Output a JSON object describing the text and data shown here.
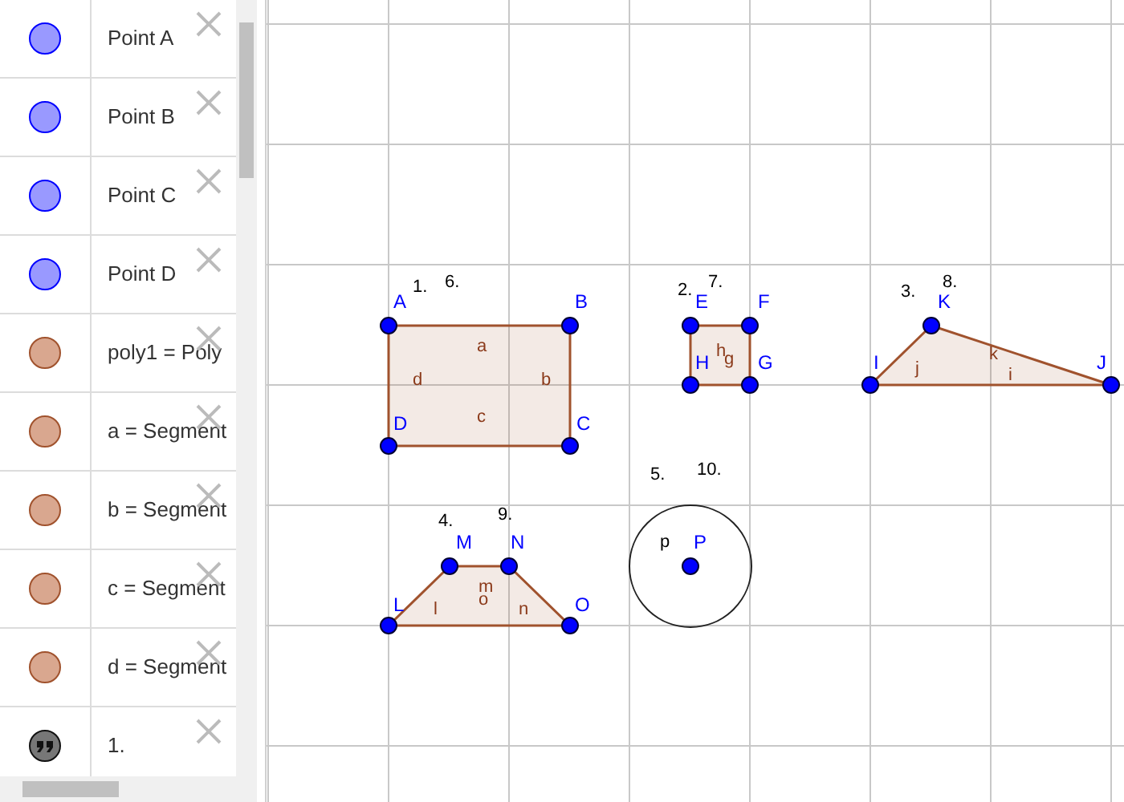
{
  "algebra_view": {
    "items": [
      {
        "kind": "point",
        "text": "Point A",
        "color": "#9999ff"
      },
      {
        "kind": "point",
        "text": "Point B",
        "color": "#9999ff"
      },
      {
        "kind": "point",
        "text": "Point C",
        "color": "#9999ff"
      },
      {
        "kind": "point",
        "text": "Point D",
        "color": "#9999ff"
      },
      {
        "kind": "object",
        "text": "poly1 = Poly",
        "color": "#d9a78f"
      },
      {
        "kind": "object",
        "text": "a = Segment",
        "color": "#d9a78f"
      },
      {
        "kind": "object",
        "text": "b = Segment",
        "color": "#d9a78f"
      },
      {
        "kind": "object",
        "text": "c = Segment",
        "color": "#d9a78f"
      },
      {
        "kind": "object",
        "text": "d = Segment",
        "color": "#d9a78f"
      },
      {
        "kind": "text",
        "text": "1."
      }
    ]
  },
  "graphics_view": {
    "point_labels": [
      "A",
      "B",
      "E",
      "F",
      "K",
      "H",
      "G",
      "I",
      "J",
      "D",
      "C",
      "M",
      "N",
      "P",
      "L",
      "O"
    ],
    "segment_labels": [
      "a",
      "h",
      "g",
      "k",
      "d",
      "b",
      "j",
      "i",
      "c",
      "p",
      "m",
      "o",
      "l",
      "n"
    ],
    "text_labels": [
      "1.",
      "6.",
      "2.",
      "7.",
      "3.",
      "8.",
      "4.",
      "9.",
      "5.",
      "10."
    ]
  }
}
